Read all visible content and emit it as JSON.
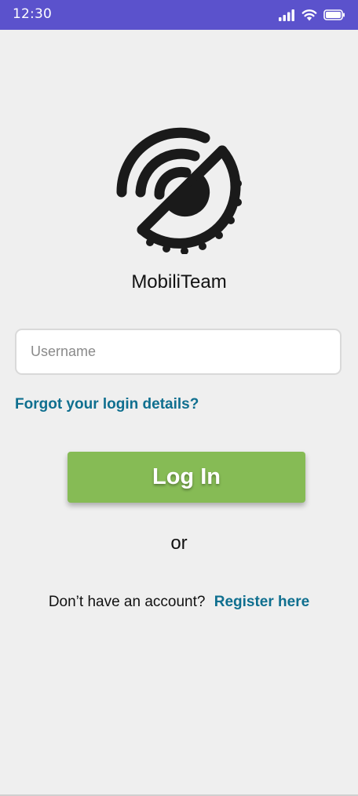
{
  "status_bar": {
    "time": "12:30",
    "background": "#5b52cc",
    "icons": [
      "signal-icon",
      "wifi-icon",
      "battery-icon"
    ]
  },
  "logo": {
    "icon": "mobiliteam-logo-icon"
  },
  "app": {
    "name": "MobiliTeam"
  },
  "login_form": {
    "username_placeholder": "Username",
    "username_value": "",
    "forgot_label": "Forgot your login details?",
    "login_button_label": "Log In",
    "or_label": "or",
    "no_account_text": "Don’t have an account?",
    "register_label": "Register here"
  },
  "colors": {
    "accent_link": "#0f6f8f",
    "login_button": "#86bb55",
    "background": "#efefef"
  }
}
